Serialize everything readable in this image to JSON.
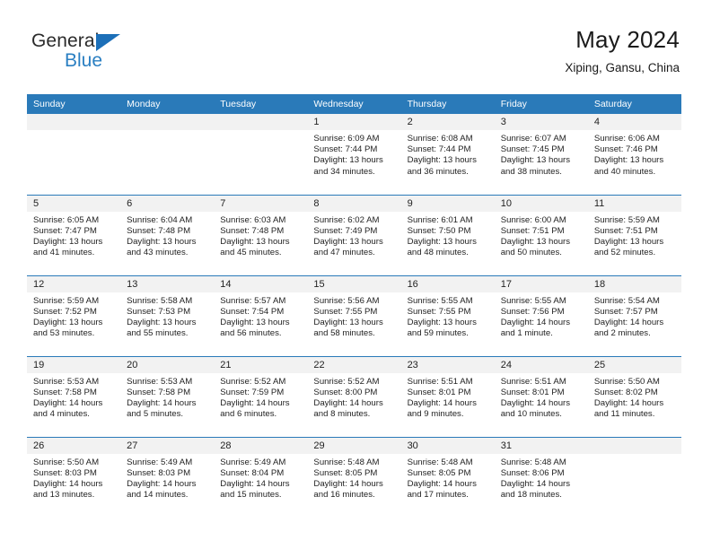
{
  "brand": {
    "name_primary": "General",
    "name_secondary": "Blue",
    "accent_color": "#2a7fc2",
    "triangle_color": "#1c6fb8"
  },
  "header": {
    "title": "May 2024",
    "subtitle": "Xiping, Gansu, China"
  },
  "calendar": {
    "header_bg": "#2a7ab9",
    "header_text_color": "#ffffff",
    "daynum_bg": "#f2f2f2",
    "weekdays": [
      "Sunday",
      "Monday",
      "Tuesday",
      "Wednesday",
      "Thursday",
      "Friday",
      "Saturday"
    ],
    "weeks": [
      [
        {
          "day": "",
          "lines": []
        },
        {
          "day": "",
          "lines": []
        },
        {
          "day": "",
          "lines": []
        },
        {
          "day": "1",
          "lines": [
            "Sunrise: 6:09 AM",
            "Sunset: 7:44 PM",
            "Daylight: 13 hours",
            "and 34 minutes."
          ]
        },
        {
          "day": "2",
          "lines": [
            "Sunrise: 6:08 AM",
            "Sunset: 7:44 PM",
            "Daylight: 13 hours",
            "and 36 minutes."
          ]
        },
        {
          "day": "3",
          "lines": [
            "Sunrise: 6:07 AM",
            "Sunset: 7:45 PM",
            "Daylight: 13 hours",
            "and 38 minutes."
          ]
        },
        {
          "day": "4",
          "lines": [
            "Sunrise: 6:06 AM",
            "Sunset: 7:46 PM",
            "Daylight: 13 hours",
            "and 40 minutes."
          ]
        }
      ],
      [
        {
          "day": "5",
          "lines": [
            "Sunrise: 6:05 AM",
            "Sunset: 7:47 PM",
            "Daylight: 13 hours",
            "and 41 minutes."
          ]
        },
        {
          "day": "6",
          "lines": [
            "Sunrise: 6:04 AM",
            "Sunset: 7:48 PM",
            "Daylight: 13 hours",
            "and 43 minutes."
          ]
        },
        {
          "day": "7",
          "lines": [
            "Sunrise: 6:03 AM",
            "Sunset: 7:48 PM",
            "Daylight: 13 hours",
            "and 45 minutes."
          ]
        },
        {
          "day": "8",
          "lines": [
            "Sunrise: 6:02 AM",
            "Sunset: 7:49 PM",
            "Daylight: 13 hours",
            "and 47 minutes."
          ]
        },
        {
          "day": "9",
          "lines": [
            "Sunrise: 6:01 AM",
            "Sunset: 7:50 PM",
            "Daylight: 13 hours",
            "and 48 minutes."
          ]
        },
        {
          "day": "10",
          "lines": [
            "Sunrise: 6:00 AM",
            "Sunset: 7:51 PM",
            "Daylight: 13 hours",
            "and 50 minutes."
          ]
        },
        {
          "day": "11",
          "lines": [
            "Sunrise: 5:59 AM",
            "Sunset: 7:51 PM",
            "Daylight: 13 hours",
            "and 52 minutes."
          ]
        }
      ],
      [
        {
          "day": "12",
          "lines": [
            "Sunrise: 5:59 AM",
            "Sunset: 7:52 PM",
            "Daylight: 13 hours",
            "and 53 minutes."
          ]
        },
        {
          "day": "13",
          "lines": [
            "Sunrise: 5:58 AM",
            "Sunset: 7:53 PM",
            "Daylight: 13 hours",
            "and 55 minutes."
          ]
        },
        {
          "day": "14",
          "lines": [
            "Sunrise: 5:57 AM",
            "Sunset: 7:54 PM",
            "Daylight: 13 hours",
            "and 56 minutes."
          ]
        },
        {
          "day": "15",
          "lines": [
            "Sunrise: 5:56 AM",
            "Sunset: 7:55 PM",
            "Daylight: 13 hours",
            "and 58 minutes."
          ]
        },
        {
          "day": "16",
          "lines": [
            "Sunrise: 5:55 AM",
            "Sunset: 7:55 PM",
            "Daylight: 13 hours",
            "and 59 minutes."
          ]
        },
        {
          "day": "17",
          "lines": [
            "Sunrise: 5:55 AM",
            "Sunset: 7:56 PM",
            "Daylight: 14 hours",
            "and 1 minute."
          ]
        },
        {
          "day": "18",
          "lines": [
            "Sunrise: 5:54 AM",
            "Sunset: 7:57 PM",
            "Daylight: 14 hours",
            "and 2 minutes."
          ]
        }
      ],
      [
        {
          "day": "19",
          "lines": [
            "Sunrise: 5:53 AM",
            "Sunset: 7:58 PM",
            "Daylight: 14 hours",
            "and 4 minutes."
          ]
        },
        {
          "day": "20",
          "lines": [
            "Sunrise: 5:53 AM",
            "Sunset: 7:58 PM",
            "Daylight: 14 hours",
            "and 5 minutes."
          ]
        },
        {
          "day": "21",
          "lines": [
            "Sunrise: 5:52 AM",
            "Sunset: 7:59 PM",
            "Daylight: 14 hours",
            "and 6 minutes."
          ]
        },
        {
          "day": "22",
          "lines": [
            "Sunrise: 5:52 AM",
            "Sunset: 8:00 PM",
            "Daylight: 14 hours",
            "and 8 minutes."
          ]
        },
        {
          "day": "23",
          "lines": [
            "Sunrise: 5:51 AM",
            "Sunset: 8:01 PM",
            "Daylight: 14 hours",
            "and 9 minutes."
          ]
        },
        {
          "day": "24",
          "lines": [
            "Sunrise: 5:51 AM",
            "Sunset: 8:01 PM",
            "Daylight: 14 hours",
            "and 10 minutes."
          ]
        },
        {
          "day": "25",
          "lines": [
            "Sunrise: 5:50 AM",
            "Sunset: 8:02 PM",
            "Daylight: 14 hours",
            "and 11 minutes."
          ]
        }
      ],
      [
        {
          "day": "26",
          "lines": [
            "Sunrise: 5:50 AM",
            "Sunset: 8:03 PM",
            "Daylight: 14 hours",
            "and 13 minutes."
          ]
        },
        {
          "day": "27",
          "lines": [
            "Sunrise: 5:49 AM",
            "Sunset: 8:03 PM",
            "Daylight: 14 hours",
            "and 14 minutes."
          ]
        },
        {
          "day": "28",
          "lines": [
            "Sunrise: 5:49 AM",
            "Sunset: 8:04 PM",
            "Daylight: 14 hours",
            "and 15 minutes."
          ]
        },
        {
          "day": "29",
          "lines": [
            "Sunrise: 5:48 AM",
            "Sunset: 8:05 PM",
            "Daylight: 14 hours",
            "and 16 minutes."
          ]
        },
        {
          "day": "30",
          "lines": [
            "Sunrise: 5:48 AM",
            "Sunset: 8:05 PM",
            "Daylight: 14 hours",
            "and 17 minutes."
          ]
        },
        {
          "day": "31",
          "lines": [
            "Sunrise: 5:48 AM",
            "Sunset: 8:06 PM",
            "Daylight: 14 hours",
            "and 18 minutes."
          ]
        },
        {
          "day": "",
          "lines": []
        }
      ]
    ]
  }
}
